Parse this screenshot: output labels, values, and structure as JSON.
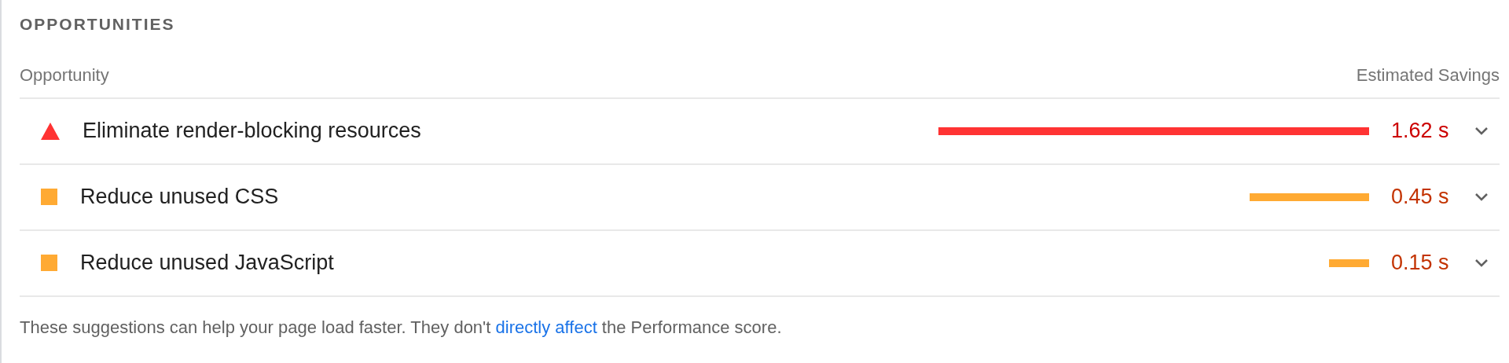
{
  "section": {
    "title": "OPPORTUNITIES"
  },
  "columns": [
    "Opportunity",
    "Estimated Savings"
  ],
  "rows": [
    {
      "kind": "fail",
      "title": "Eliminate render-blocking resources",
      "savings": "1.62 s",
      "expanded": false
    },
    {
      "kind": "average",
      "title": "Reduce unused CSS",
      "savings": "0.45 s",
      "expanded": false
    },
    {
      "kind": "average",
      "title": "Reduce unused JavaScript",
      "savings": "0.15 s",
      "expanded": false
    }
  ],
  "footer": {
    "before": "These suggestions can help your page load faster. They don't ",
    "link": "directly affect",
    "after": " the Performance score."
  }
}
